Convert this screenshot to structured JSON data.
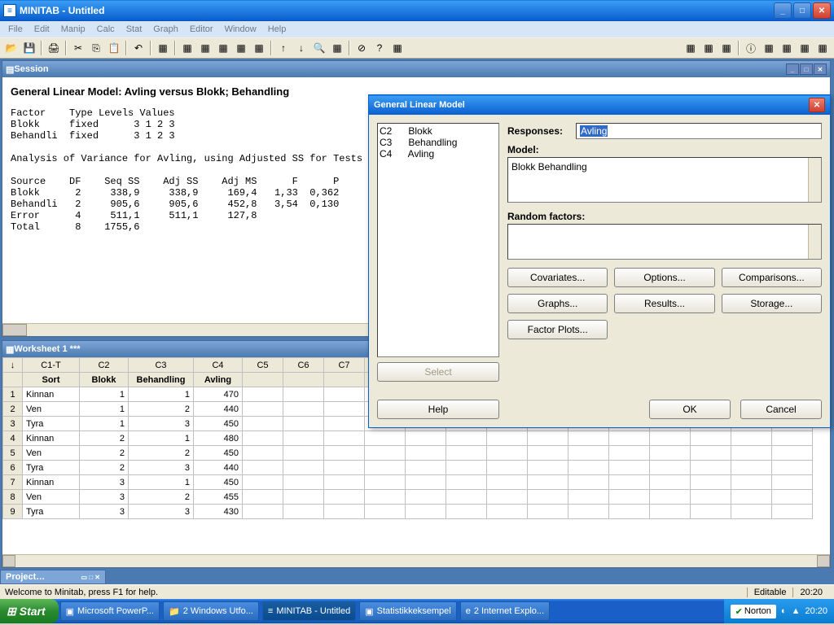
{
  "app": {
    "title": "MINITAB - Untitled"
  },
  "menu": [
    "File",
    "Edit",
    "Manip",
    "Calc",
    "Stat",
    "Graph",
    "Editor",
    "Window",
    "Help"
  ],
  "session": {
    "title": "Session",
    "heading": "General Linear Model: Avling versus Blokk; Behandling",
    "body": "Factor    Type Levels Values\nBlokk     fixed      3 1 2 3\nBehandli  fixed      3 1 2 3\n\nAnalysis of Variance for Avling, using Adjusted SS for Tests\n\nSource    DF    Seq SS    Adj SS    Adj MS      F      P\nBlokk      2     338,9     338,9     169,4   1,33  0,362\nBehandli   2     905,6     905,6     452,8   3,54  0,130\nError      4     511,1     511,1     127,8\nTotal      8    1755,6"
  },
  "worksheet": {
    "title": "Worksheet 1 ***",
    "cols": [
      "C1-T",
      "C2",
      "C3",
      "C4",
      "C5",
      "C6",
      "C7"
    ],
    "names": [
      "Sort",
      "Blokk",
      "Behandling",
      "Avling",
      "",
      "",
      ""
    ],
    "rows": [
      [
        "Kinnan",
        "1",
        "1",
        "470"
      ],
      [
        "Ven",
        "1",
        "2",
        "440"
      ],
      [
        "Tyra",
        "1",
        "3",
        "450"
      ],
      [
        "Kinnan",
        "2",
        "1",
        "480"
      ],
      [
        "Ven",
        "2",
        "2",
        "450"
      ],
      [
        "Tyra",
        "2",
        "3",
        "440"
      ],
      [
        "Kinnan",
        "3",
        "1",
        "450"
      ],
      [
        "Ven",
        "3",
        "2",
        "455"
      ],
      [
        "Tyra",
        "3",
        "3",
        "430"
      ]
    ]
  },
  "project": {
    "title": "Project…"
  },
  "dialog": {
    "title": "General Linear Model",
    "columns": "C2      Blokk\nC3      Behandling\nC4      Avling",
    "responses_label": "Responses:",
    "responses_value": "Avling",
    "model_label": "Model:",
    "model_value": "Blokk Behandling",
    "random_label": "Random factors:",
    "random_value": "",
    "buttons": {
      "covariates": "Covariates...",
      "options": "Options...",
      "comparisons": "Comparisons...",
      "graphs": "Graphs...",
      "results": "Results...",
      "storage": "Storage...",
      "factorplots": "Factor Plots...",
      "select": "Select",
      "help": "Help",
      "ok": "OK",
      "cancel": "Cancel"
    }
  },
  "status": {
    "msg": "Welcome to Minitab, press F1 for help.",
    "mode": "Editable",
    "time": "20:20"
  },
  "taskbar": {
    "start": "Start",
    "items": [
      "Microsoft PowerP...",
      "2 Windows Utfo...",
      "MINITAB - Untitled",
      "Statistikkeksempel",
      "2 Internet Explo..."
    ],
    "norton": "Norton",
    "clock": "20:20"
  }
}
